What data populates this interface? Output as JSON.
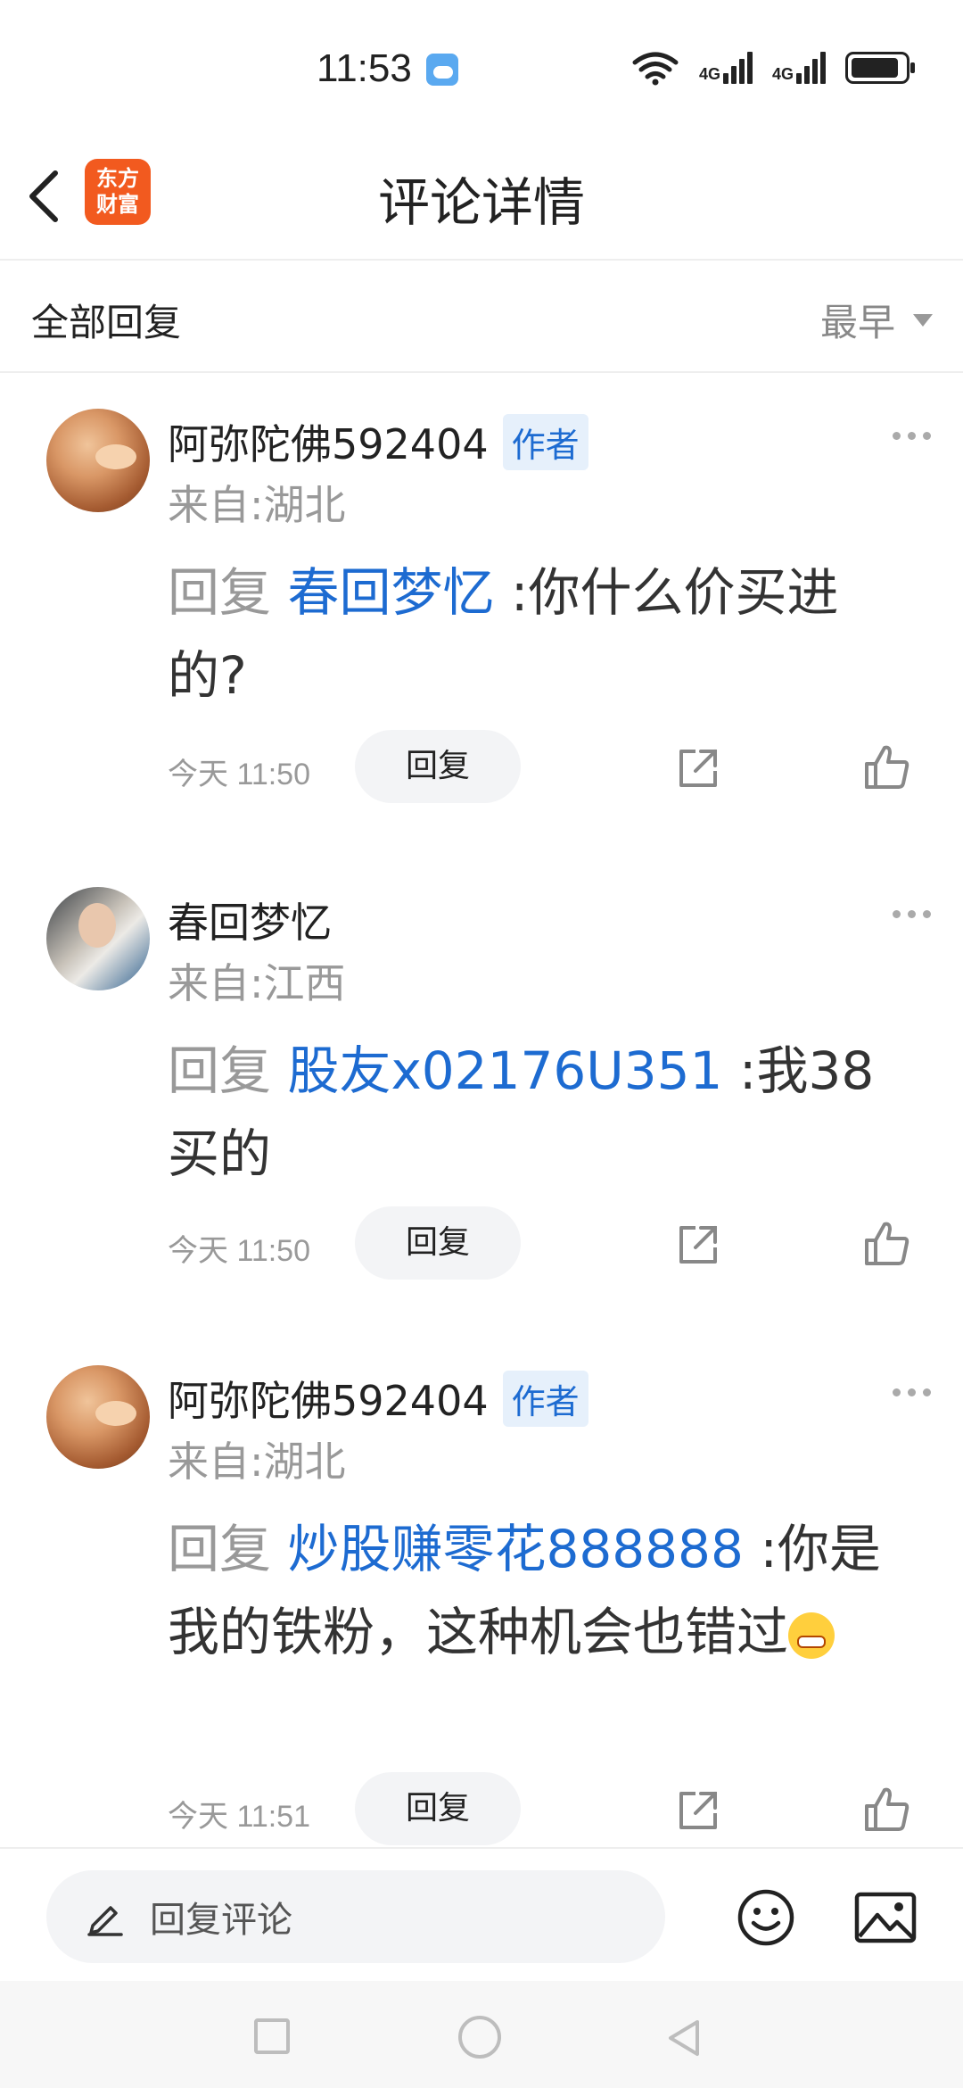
{
  "status": {
    "time": "11:53",
    "network1": "4G",
    "network2": "4G"
  },
  "nav": {
    "title": "评论详情",
    "logo_text": "东方\n财富"
  },
  "filter": {
    "label": "全部回复",
    "sort": "最早"
  },
  "comments": [
    {
      "name": "阿弥陀佛592404",
      "tag": "作者",
      "location": "来自:湖北",
      "reply_prefix": "回复",
      "reply_to": "春回梦忆",
      "separator": ":",
      "text": "你什么价买进的?",
      "time": "今天 11:50",
      "reply_label": "回复"
    },
    {
      "name": "春回梦忆",
      "tag": "",
      "location": "来自:江西",
      "reply_prefix": "回复",
      "reply_to": "股友x02176U351",
      "separator": ":",
      "text": "我38买的",
      "time": "今天 11:50",
      "reply_label": "回复"
    },
    {
      "name": "阿弥陀佛592404",
      "tag": "作者",
      "location": "来自:湖北",
      "reply_prefix": "回复",
      "reply_to": "炒股赚零花888888",
      "separator": ":",
      "text": "你是我的铁粉，这种机会也错过",
      "time": "今天 11:51",
      "reply_label": "回复"
    }
  ],
  "bottom": {
    "input_placeholder": "回复评论"
  },
  "icons": {
    "emoji": "grimacing-face-emoji"
  }
}
